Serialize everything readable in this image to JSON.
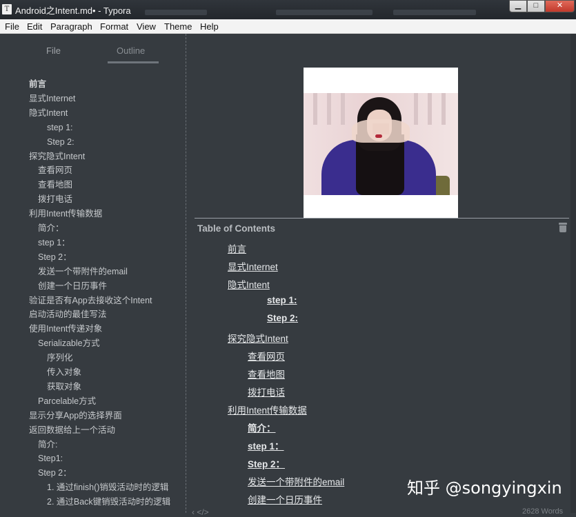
{
  "window": {
    "icon_letter": "T",
    "title": "Android之Intent.md• - Typora",
    "controls": {
      "minimize": "▁",
      "maximize": "□",
      "close": "✕"
    }
  },
  "menu": [
    "File",
    "Edit",
    "Paragraph",
    "Format",
    "View",
    "Theme",
    "Help"
  ],
  "sidebar": {
    "tabs": [
      "File",
      "Outline"
    ],
    "outline": [
      {
        "label": "前言",
        "level": 1,
        "bold": true
      },
      {
        "label": "显式Internet",
        "level": 1
      },
      {
        "label": "隐式Intent",
        "level": 1
      },
      {
        "label": "step 1:",
        "level": 3
      },
      {
        "label": "Step 2:",
        "level": 3
      },
      {
        "label": "探究隐式Intent",
        "level": 1
      },
      {
        "label": "查看网页",
        "level": 2
      },
      {
        "label": "查看地图",
        "level": 2
      },
      {
        "label": "拨打电话",
        "level": 2
      },
      {
        "label": "利用Intent传输数据",
        "level": 1
      },
      {
        "label": "简介：",
        "level": 2
      },
      {
        "label": "step 1：",
        "level": 2
      },
      {
        "label": "Step 2：",
        "level": 2
      },
      {
        "label": "发送一个带附件的email",
        "level": 2
      },
      {
        "label": "创建一个日历事件",
        "level": 2
      },
      {
        "label": "验证是否有App去接收这个Intent",
        "level": 1
      },
      {
        "label": "启动活动的最佳写法",
        "level": 1
      },
      {
        "label": "使用Intent传递对象",
        "level": 1
      },
      {
        "label": "Serializable方式",
        "level": 2
      },
      {
        "label": "序列化",
        "level": 3
      },
      {
        "label": "传入对象",
        "level": 3
      },
      {
        "label": "获取对象",
        "level": 3
      },
      {
        "label": "Parcelable方式",
        "level": 2
      },
      {
        "label": "显示分享App的选择界面",
        "level": 1
      },
      {
        "label": "返回数据给上一个活动",
        "level": 1
      },
      {
        "label": "简介:",
        "level": 2
      },
      {
        "label": "Step1:",
        "level": 2
      },
      {
        "label": "Step 2：",
        "level": 2
      },
      {
        "label": "1. 通过finish()销毁活动时的逻辑",
        "level": 3
      },
      {
        "label": "2. 通过Back键销毁活动时的逻辑",
        "level": 3
      }
    ]
  },
  "toc": {
    "heading": "Table of Contents",
    "items": [
      {
        "label": "前言",
        "level": 1
      },
      {
        "label": "显式Internet",
        "level": 1
      },
      {
        "label": "隐式Intent",
        "level": 1
      },
      {
        "label": "step 1:",
        "level": 3,
        "bold": true
      },
      {
        "label": "Step 2:",
        "level": 3,
        "bold": true
      },
      {
        "label": "探究隐式Intent",
        "level": 1
      },
      {
        "label": "查看网页",
        "level": 2
      },
      {
        "label": "查看地图",
        "level": 2
      },
      {
        "label": "拨打电话",
        "level": 2
      },
      {
        "label": "利用Intent传输数据",
        "level": 1
      },
      {
        "label": "简介：",
        "level": 2,
        "bold": true
      },
      {
        "label": "step 1：",
        "level": 2,
        "bold": true
      },
      {
        "label": "Step 2：",
        "level": 2,
        "bold": true
      },
      {
        "label": "发送一个带附件的email",
        "level": 2
      },
      {
        "label": "创建一个日历事件",
        "level": 2
      }
    ]
  },
  "watermark": "知乎 @songyingxin",
  "status": {
    "word_count": "2628 Words",
    "footer_icons": "‹  </>"
  },
  "icons": {
    "toc_delete": "trash-icon"
  }
}
